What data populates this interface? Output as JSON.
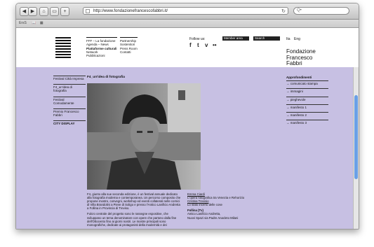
{
  "browser": {
    "url": "http://www.fondazionefrancescofabbri.it/",
    "search_placeholder": "Q•",
    "bookmarks_label": "ErsS"
  },
  "site": {
    "nav_col1": [
      "FFF – La fondazione",
      "Agenda – News",
      "Piattaforme culturali",
      "Network",
      "Pubblicazioni"
    ],
    "nav_col2": [
      "Partnership",
      "Sostenitori",
      "Press Room",
      "Contatti"
    ],
    "follow_label": "Follow us:",
    "social": [
      "f",
      "t",
      "v",
      "••"
    ],
    "member_area": "Member area",
    "search_label": "Search",
    "langs": [
      "Ita",
      "Eng"
    ],
    "brand": [
      "Fondazione",
      "Francesco",
      "Fabbri"
    ]
  },
  "leftnav": [
    "Festival Città Impresa",
    "F4_un'idea di fotografia",
    "Festival Comodamente",
    "Premio Francesco Fabbri",
    "CITY DISPLAY"
  ],
  "article": {
    "title": "F4_un'idea di fotografia",
    "caption_p1": "F4, giunto alla sue seconda edizione, è un festival annuale dedicato alla fotografia moderna e contemporanea. Un percorso composito che propone mostre, convegni, workshop ed eventi collaterali nelle cornici di Villa Brandolini a Pieve di Soligo e presso l'Antico Lanificio Andretta a Follina in Provincia di Treviso.",
    "caption_p2": "Fulcro centrale del progetto sono le rassegne espositive, che sviluppano un tema denominatore con opere che partono dalla fine dell'Ottocento fino ai giorni nostri. Le mostre principali sono monografiche, dedicate ai protagonisti della modernità e dei",
    "credit_name1": "Emma Ciardi",
    "credit_text1": "L'opera fotografica tra Venezia e Rehorizio",
    "credit_name2": "Cristina Trevisio",
    "credit_text2": "Lo stato incerto delle cose",
    "credit_head": "Follina (Tv)",
    "credit_text3": "Antico Lanificio Andretta,",
    "credit_text4": "Nuovi Spazi via Padre Anacleto Milani"
  },
  "sidebar": {
    "title": "Approfondimenti",
    "items": [
      "→ comunicato stampa",
      "→ immagini",
      "→ pieghevole",
      "→ manifesto 1",
      "→ manifesto 2",
      "→ manifesto 3"
    ]
  }
}
